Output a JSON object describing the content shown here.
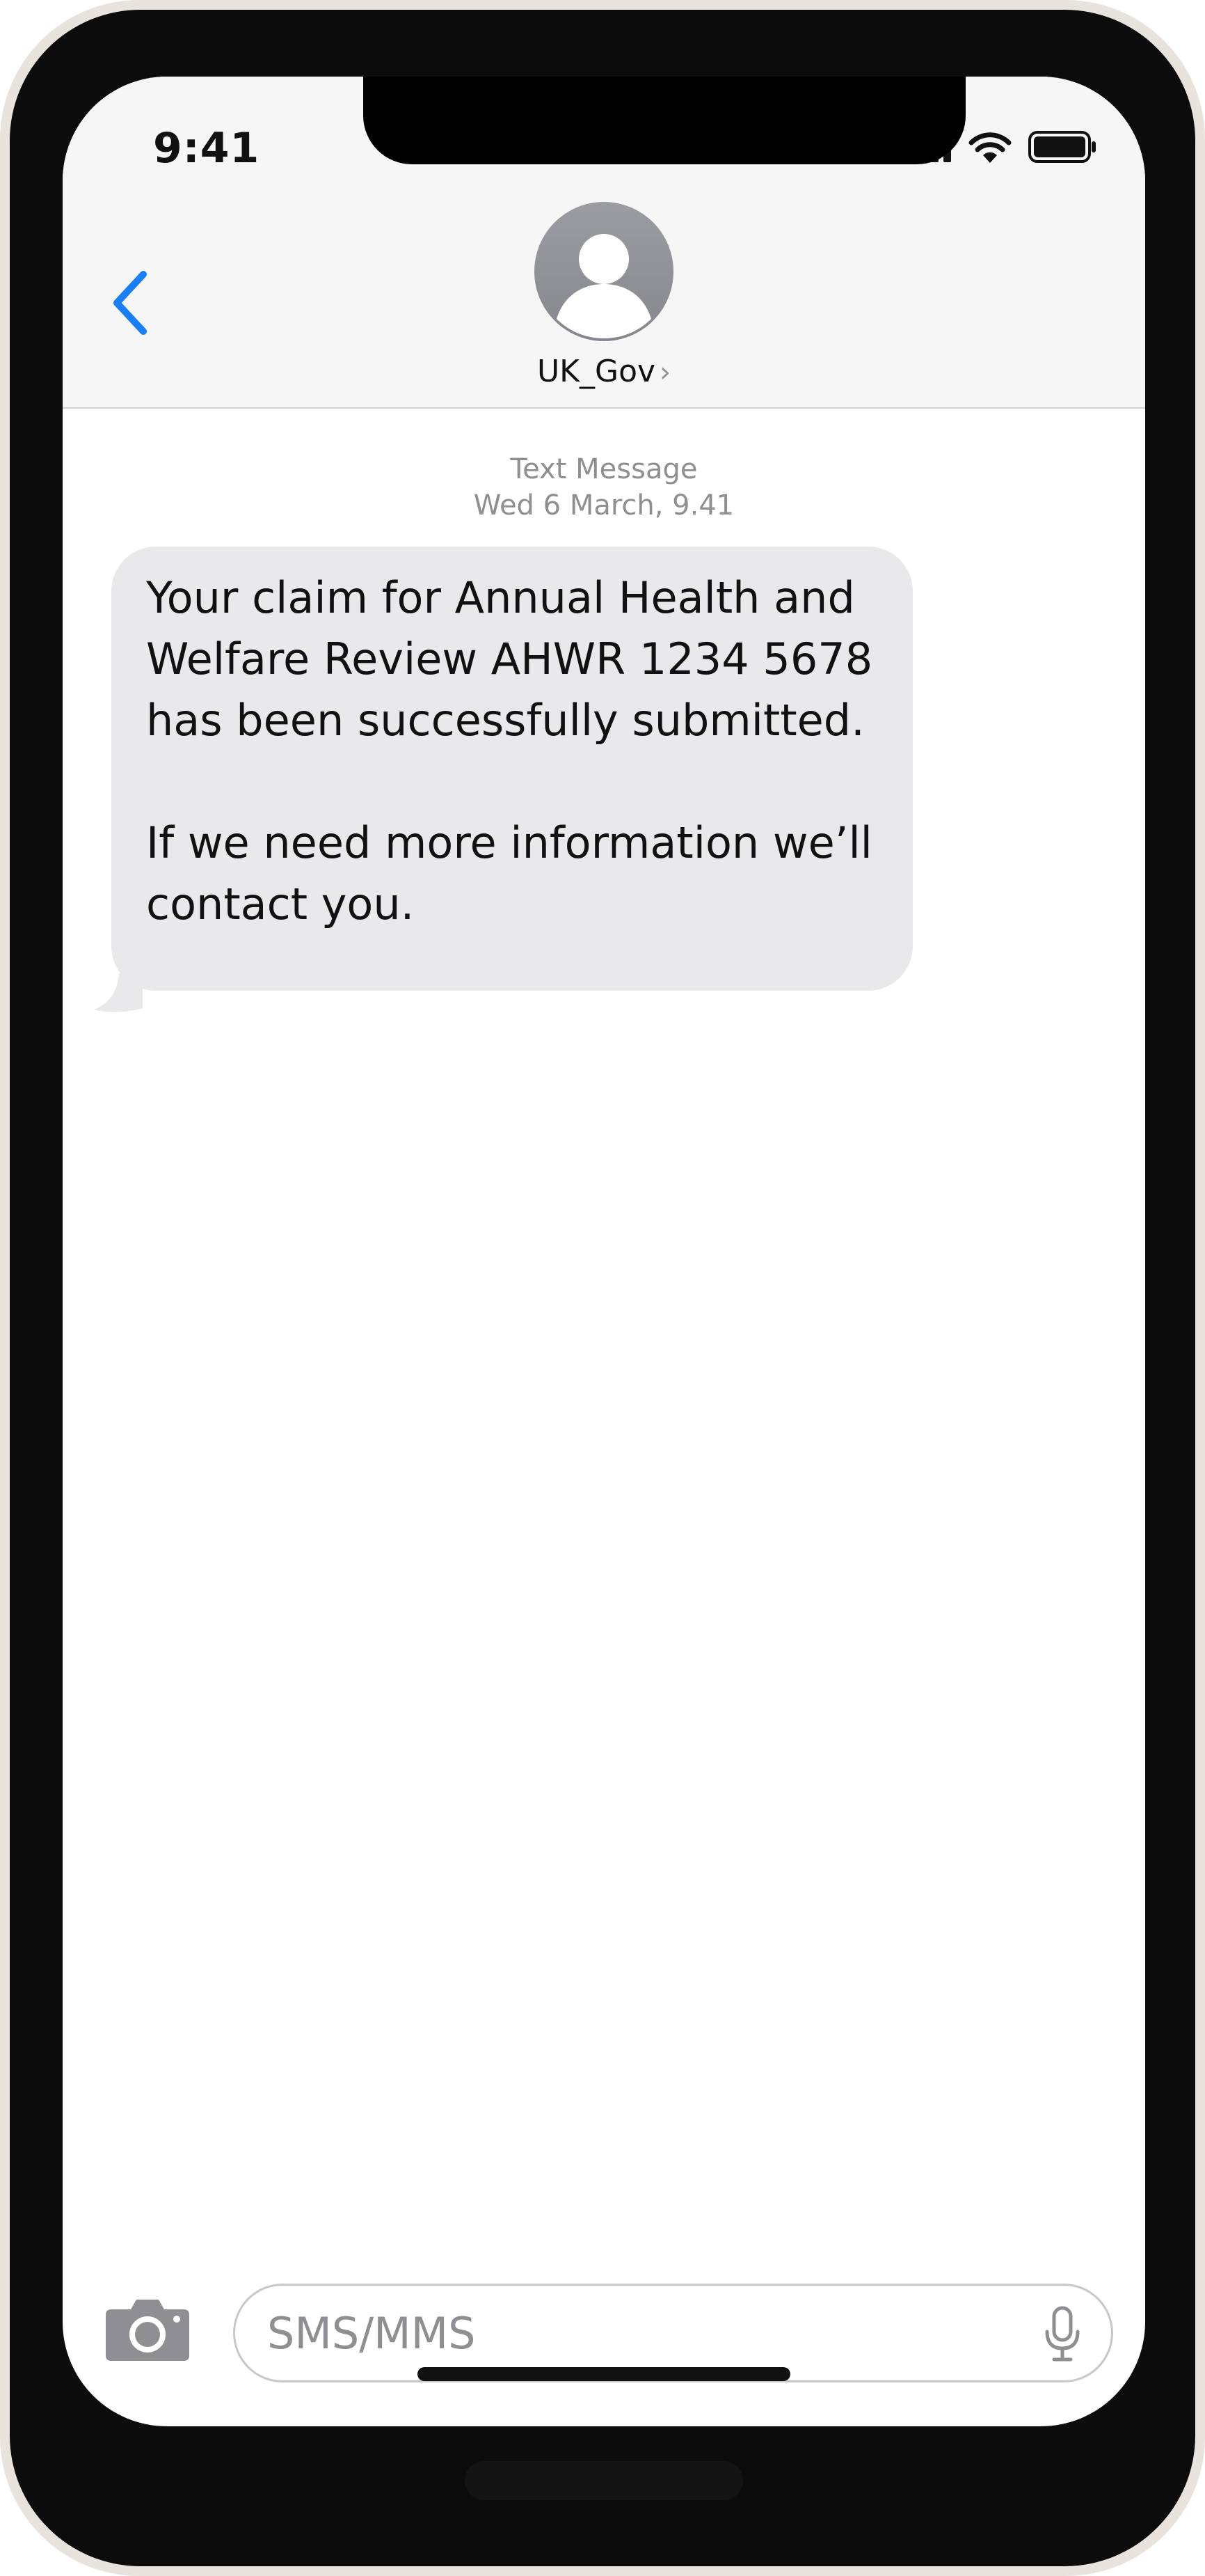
{
  "status_bar": {
    "time": "9:41",
    "icons": [
      "cellular-signal-icon",
      "wifi-icon",
      "battery-icon"
    ]
  },
  "header": {
    "back_icon": "chevron-left-icon",
    "avatar_icon": "person-silhouette-icon",
    "contact_name": "UK_Gov",
    "contact_chevron": "›"
  },
  "conversation": {
    "service_label": "Text Message",
    "timestamp": "Wed 6 March, 9.41",
    "messages": [
      {
        "direction": "incoming",
        "text": "Your claim for Annual Health and Welfare Review AHWR 1234 5678 has been successfully submitted.\n\nIf we need more information we’ll contact you."
      }
    ]
  },
  "composer": {
    "camera_icon": "camera-icon",
    "placeholder": "SMS/MMS",
    "mic_icon": "microphone-icon"
  },
  "colors": {
    "accent": "#1a7ff3",
    "bubble_incoming": "#e9e9eb",
    "meta_text": "#8e8e93",
    "header_bg": "#f6f6f6",
    "bezel": "#0c0c0c",
    "frame": "#e9e3de"
  }
}
